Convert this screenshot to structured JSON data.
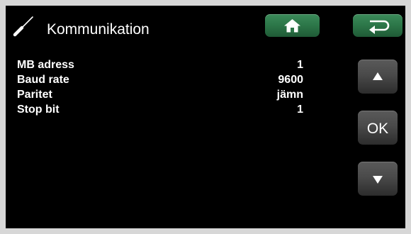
{
  "header": {
    "title": "Kommunikation",
    "icons": {
      "tool": "screwdriver-icon",
      "home": "home-icon",
      "back": "back-arrow-icon"
    }
  },
  "settings": [
    {
      "label": "MB adress",
      "value": "1"
    },
    {
      "label": "Baud rate",
      "value": "9600"
    },
    {
      "label": "Paritet",
      "value": "jämn"
    },
    {
      "label": "Stop bit",
      "value": "1"
    }
  ],
  "nav": {
    "ok_label": "OK",
    "icons": {
      "up": "up-arrow-icon",
      "down": "down-arrow-icon"
    }
  },
  "colors": {
    "background": "#000000",
    "frame": "#d7d7d7",
    "accent_green": "#2c7648",
    "button_gray": "#4a4a4a",
    "text": "#ffffff"
  }
}
